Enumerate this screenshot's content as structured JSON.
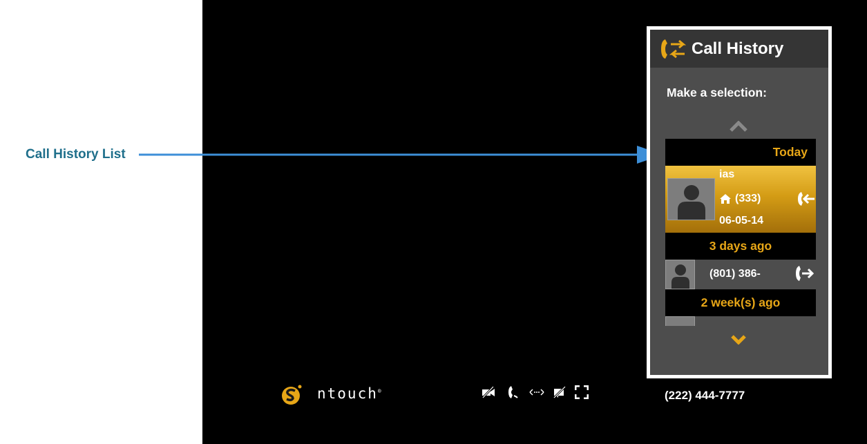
{
  "callout": {
    "label": "Call History List"
  },
  "panel": {
    "title": "Call History",
    "prompt": "Make a selection:",
    "groups": [
      {
        "label": "Today"
      },
      {
        "label": "3 days ago"
      },
      {
        "label": "2 week(s) ago"
      }
    ],
    "entries": [
      {
        "name": "ias",
        "phone": "(333)",
        "date": "06-05-14",
        "phone_type_icon": "home-icon",
        "direction_icon": "incoming-call-icon",
        "selected": true
      },
      {
        "phone": "(801) 386-",
        "direction_icon": "outgoing-call-icon",
        "selected": false
      }
    ]
  },
  "bottom_bar": {
    "brand": "ntouch",
    "own_number": "(222) 444-7777",
    "controls": [
      "video-off-icon",
      "phone-icon",
      "switch-icon",
      "privacy-icon",
      "fullscreen-icon"
    ]
  },
  "colors": {
    "accent": "#e7a617",
    "callout": "#1f6f8b",
    "arrow": "#3d8fd8",
    "panel_bg": "#4d4d4d",
    "header_bg": "#353535"
  }
}
